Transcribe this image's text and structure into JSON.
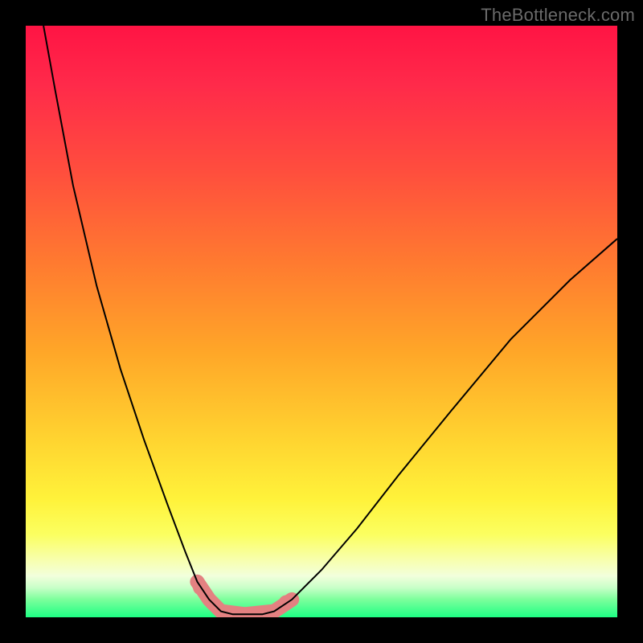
{
  "watermark": "TheBottleneck.com",
  "colors": {
    "background_black": "#000000",
    "gradient_top": "#ff1444",
    "gradient_mid": "#ffd430",
    "gradient_bottom": "#1eff84",
    "curve": "#000000",
    "marker": "#e38181"
  },
  "chart_data": {
    "type": "line",
    "title": "",
    "xlabel": "",
    "ylabel": "",
    "xlim": [
      0,
      100
    ],
    "ylim": [
      0,
      100
    ],
    "grid": false,
    "legend": false,
    "annotations": [
      "TheBottleneck.com"
    ],
    "series": [
      {
        "name": "left-branch",
        "x": [
          3,
          5,
          8,
          12,
          16,
          20,
          24,
          27,
          29,
          31,
          33
        ],
        "y": [
          100,
          89,
          73,
          56,
          42,
          30,
          19,
          11,
          6,
          3,
          1
        ]
      },
      {
        "name": "right-branch",
        "x": [
          42,
          45,
          50,
          56,
          63,
          72,
          82,
          92,
          100
        ],
        "y": [
          1,
          3,
          8,
          15,
          24,
          35,
          47,
          57,
          64
        ]
      },
      {
        "name": "valley-floor",
        "x": [
          33,
          35,
          37,
          40,
          42
        ],
        "y": [
          1,
          0.5,
          0.5,
          0.5,
          1
        ]
      }
    ],
    "markers": {
      "name": "highlighted-bottleneck-region",
      "points": [
        {
          "x": 29,
          "y": 6
        },
        {
          "x": 31,
          "y": 3
        },
        {
          "x": 33,
          "y": 1
        },
        {
          "x": 37,
          "y": 0.5
        },
        {
          "x": 42,
          "y": 1
        },
        {
          "x": 45,
          "y": 3
        }
      ],
      "dots": [
        {
          "x": 29.5,
          "y": 5
        },
        {
          "x": 31.5,
          "y": 2.5
        },
        {
          "x": 44,
          "y": 2.5
        }
      ]
    }
  }
}
